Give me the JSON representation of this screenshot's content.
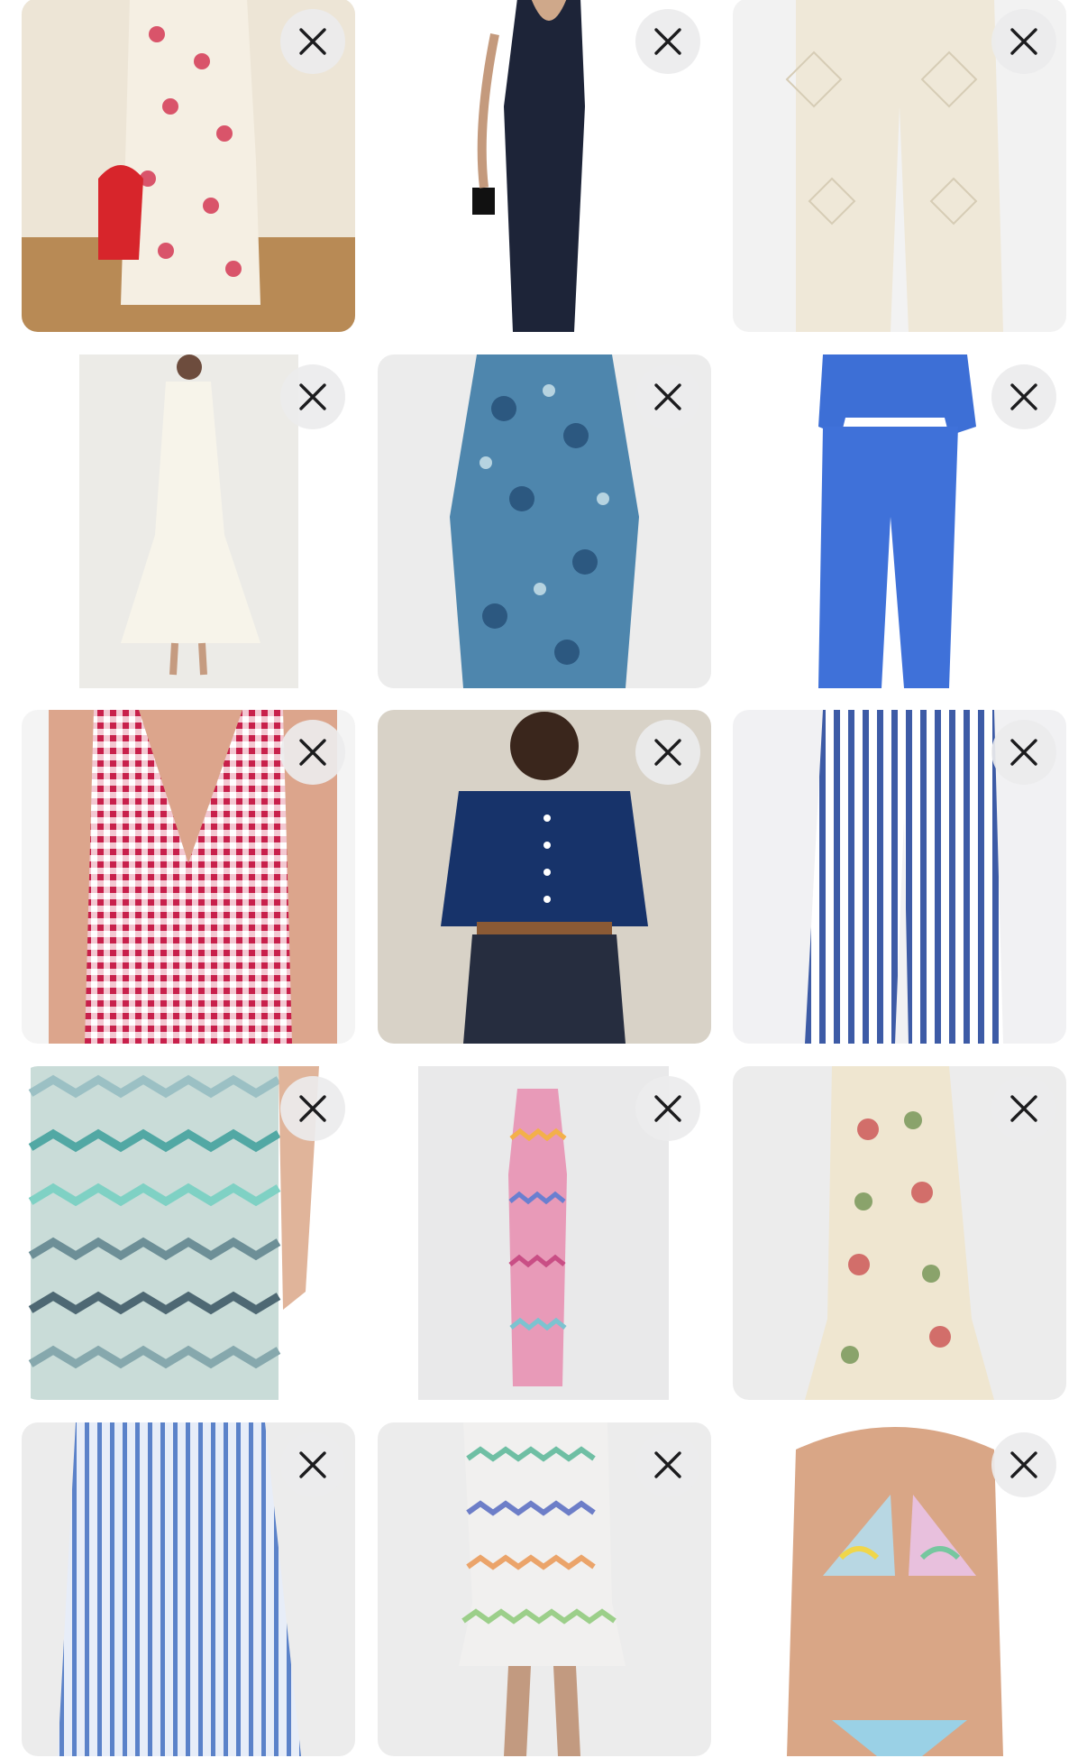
{
  "grid": {
    "items": [
      {
        "name": "floral-jumpsuit",
        "icon": "close-icon"
      },
      {
        "name": "navy-maxi-dress",
        "icon": "close-icon"
      },
      {
        "name": "crochet-pants",
        "icon": "close-icon"
      },
      {
        "name": "white-halter-dress",
        "icon": "close-icon"
      },
      {
        "name": "blue-paisley-dress",
        "icon": "close-icon"
      },
      {
        "name": "blue-linen-set",
        "icon": "close-icon"
      },
      {
        "name": "gingham-swimsuit",
        "icon": "close-icon"
      },
      {
        "name": "denim-shirt-shorts",
        "icon": "close-icon"
      },
      {
        "name": "striped-pants",
        "icon": "close-icon"
      },
      {
        "name": "zigzag-knit-skirt",
        "icon": "close-icon"
      },
      {
        "name": "zigzag-maxi-dress",
        "icon": "close-icon"
      },
      {
        "name": "paisley-ruffle-dress",
        "icon": "close-icon"
      },
      {
        "name": "striped-maxi-skirt",
        "icon": "close-icon"
      },
      {
        "name": "zigzag-mini-dress",
        "icon": "close-icon"
      },
      {
        "name": "swirl-bikini",
        "icon": "close-icon"
      }
    ]
  },
  "colors": {
    "close_bg": "#ebebed",
    "close_x": "#1c1c1e"
  }
}
